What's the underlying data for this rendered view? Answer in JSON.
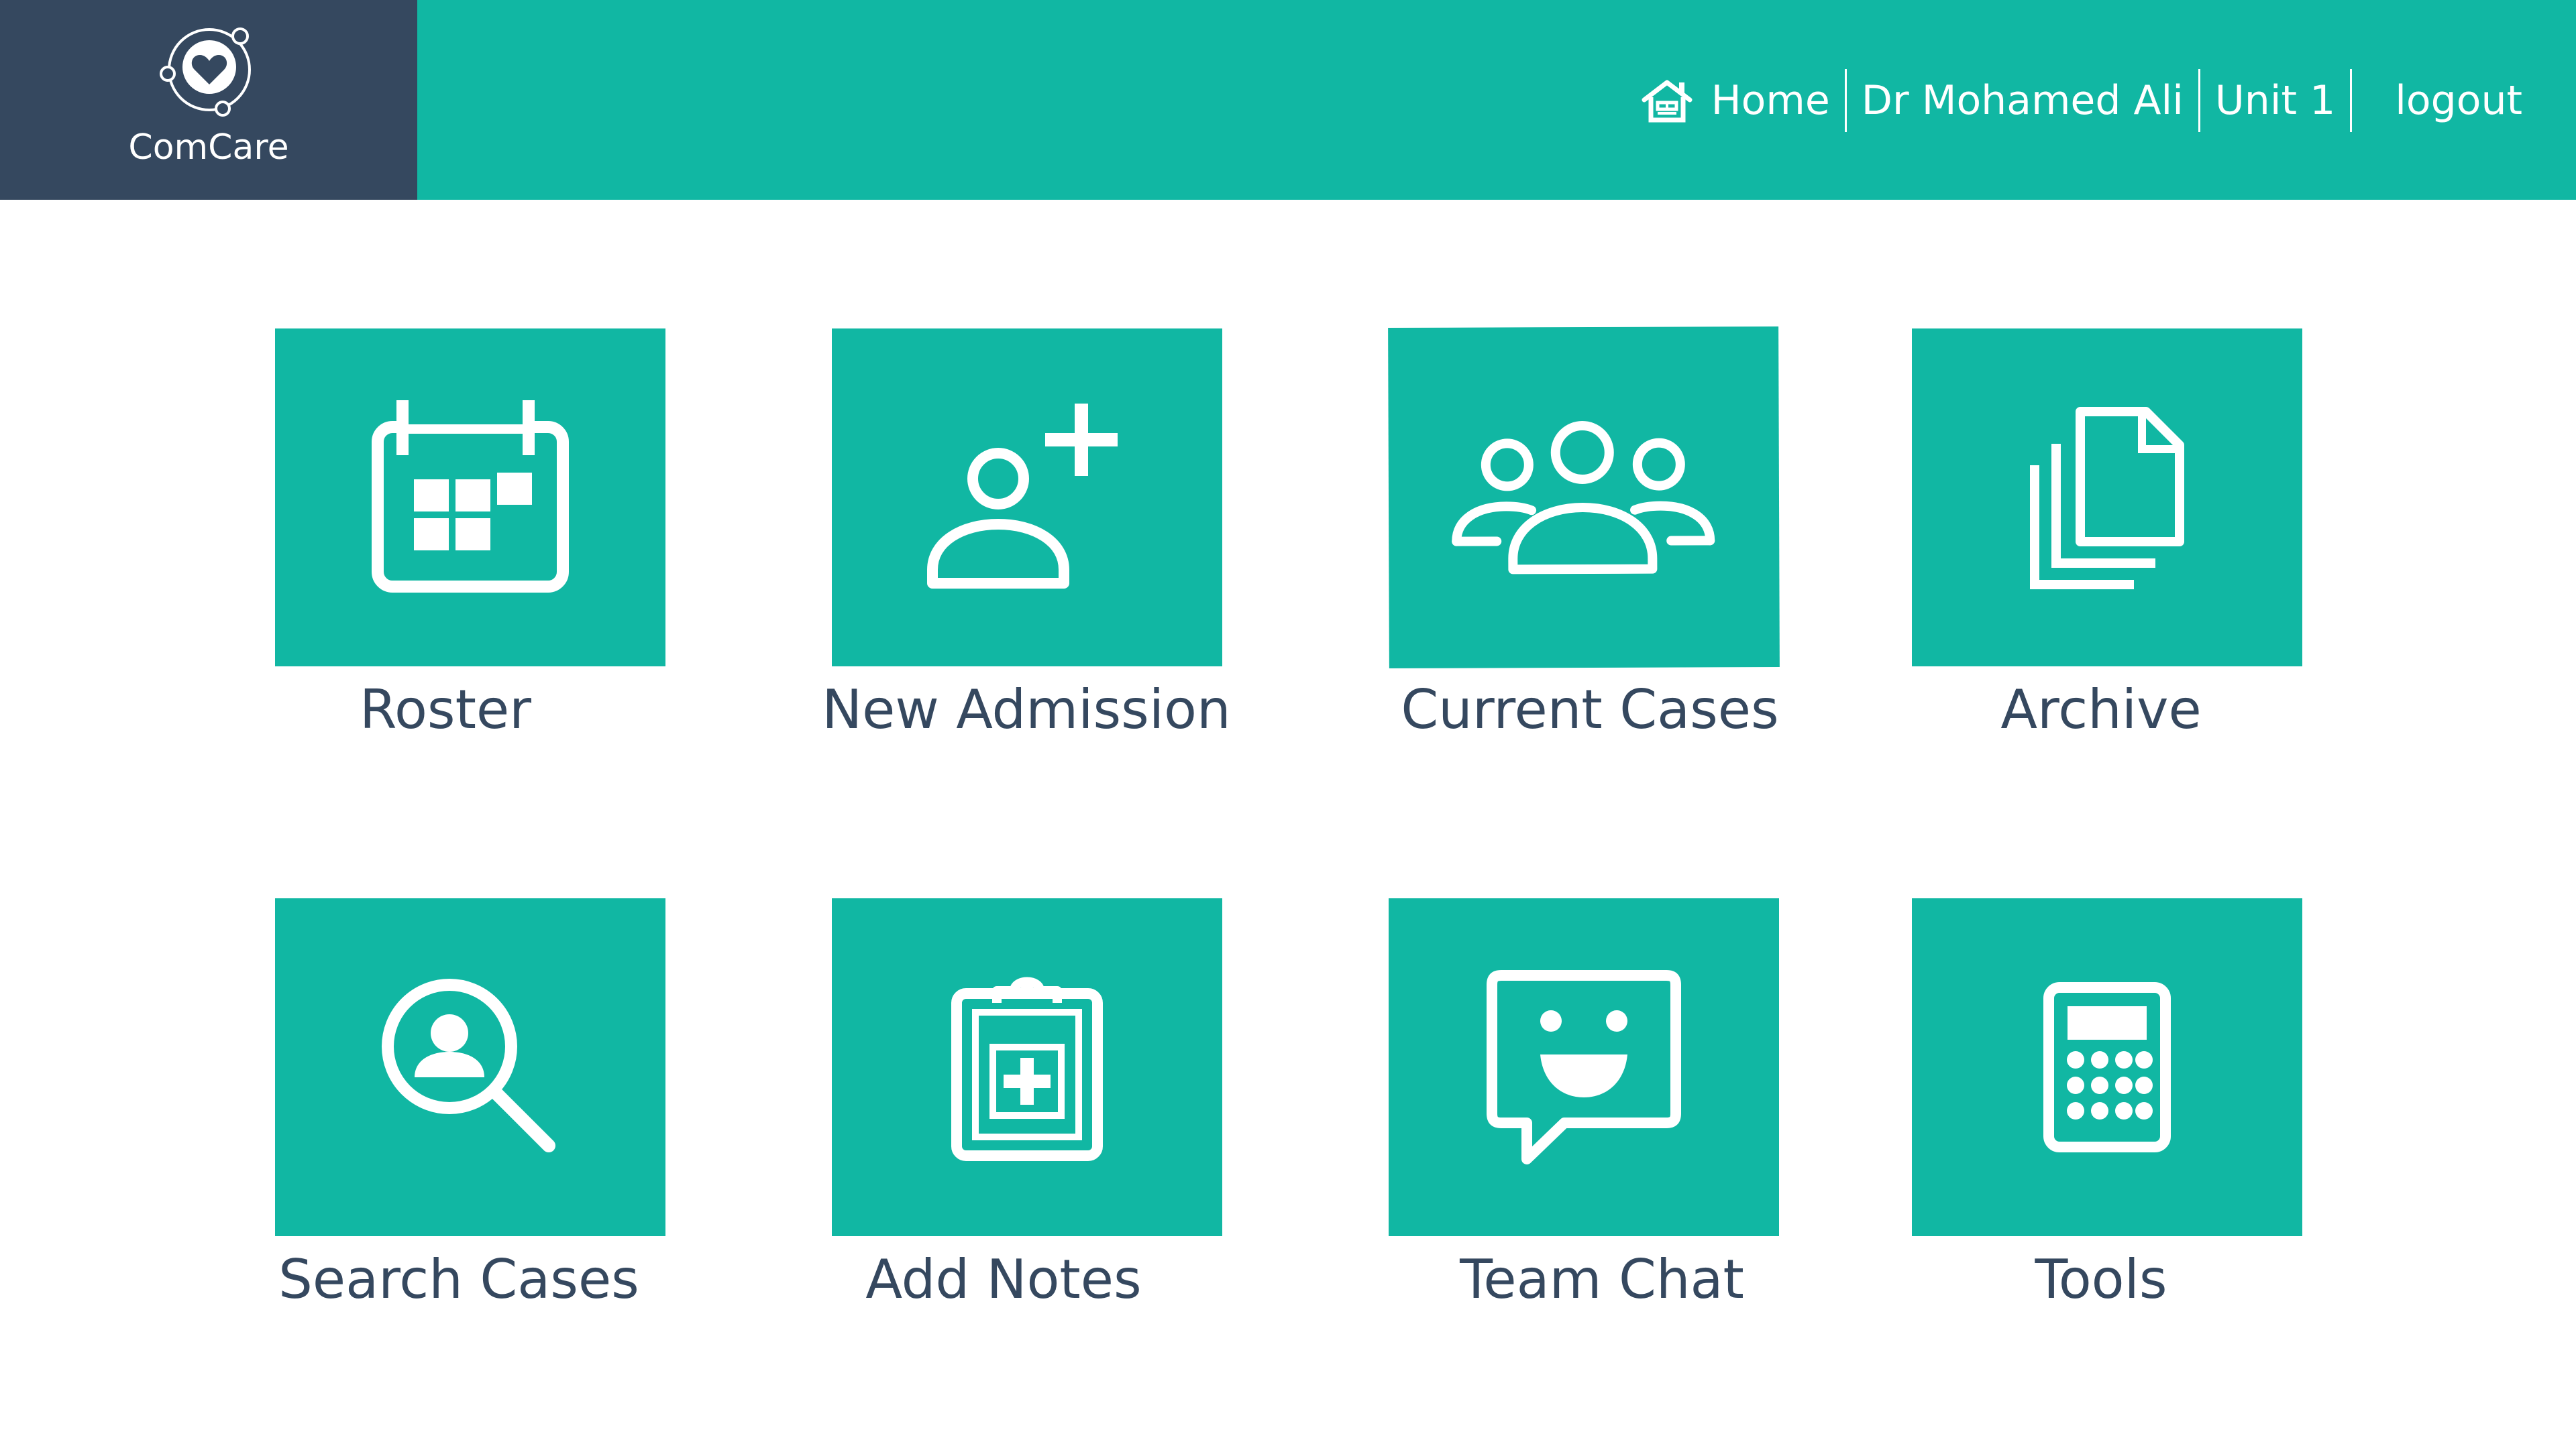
{
  "app": {
    "brand_name": "ComCare",
    "logo_icon": "heart-circle-logo"
  },
  "colors": {
    "accent": "#11b7a3",
    "brand_panel": "#35485f",
    "label_text": "#35485f"
  },
  "nav": {
    "home_label": "Home",
    "home_icon": "house-icon",
    "user_label": "Dr Mohamed Ali",
    "unit_label": "Unit 1",
    "logout_label": "logout"
  },
  "tiles": [
    {
      "label": "Roster",
      "icon": "calendar-icon"
    },
    {
      "label": "New Admission",
      "icon": "add-person-icon"
    },
    {
      "label": "Current Cases",
      "icon": "group-icon"
    },
    {
      "label": "Archive",
      "icon": "documents-icon"
    },
    {
      "label": "Search Cases",
      "icon": "search-person-icon"
    },
    {
      "label": "Add Notes",
      "icon": "medical-clipboard-icon"
    },
    {
      "label": "Team Chat",
      "icon": "smiley-chat-icon"
    },
    {
      "label": "Tools",
      "icon": "calculator-icon"
    }
  ]
}
